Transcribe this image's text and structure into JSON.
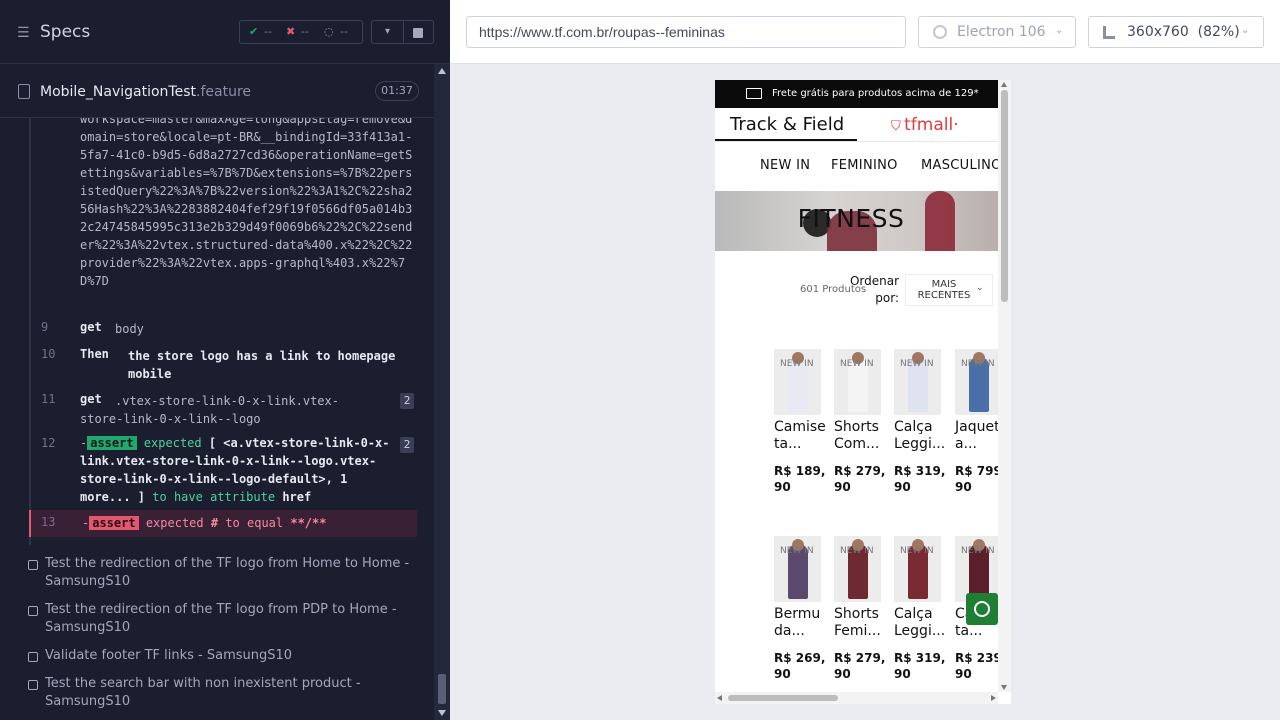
{
  "reporter": {
    "title": "Specs",
    "stats": {
      "passed": "--",
      "failed": "--",
      "pending": "--"
    },
    "file": {
      "name": "Mobile_NavigationTest",
      "ext": ".feature",
      "duration": "01:37"
    },
    "url_fragment": "workspace=master&maxAge=long&appsEtag=remove&domain=store&locale=pt-BR&__bindingId=33f413a1-5fa7-41c0-b9d5-6d8a2727cd36&operationName=getSettings&variables=%7B%7D&extensions=%7B%22persistedQuery%22%3A%7B%22version%22%3A1%2C%22sha256Hash%22%3A%2283882404fef29f19f0566df05a014b32c24745845995c313e2b329d49f0069b6%22%2C%22sender%22%3A%22vtex.structured-data%400.x%22%2C%22provider%22%3A%22vtex.apps-graphql%403.x%22%7D%7D",
    "commands": [
      {
        "line": "9",
        "name": "get",
        "message": "body"
      },
      {
        "line": "10",
        "name": "Then",
        "message": "the store logo has a link to homepage mobile"
      },
      {
        "line": "11",
        "name": "get",
        "message": ".vtex-store-link-0-x-link.vtex-store-link-0-x-link--logo",
        "count": "2"
      },
      {
        "line": "12",
        "prefix": "-",
        "name": "assert",
        "msg_a": "expected",
        "msg_b": "[ <a.vtex-store-link-0-x-link.vtex-store-link-0-x-link--logo.vtex-store-link-0-x-link--logo-default>, 1 more... ]",
        "msg_c": "to have attribute",
        "msg_d": "href",
        "count": "2"
      },
      {
        "line": "13",
        "prefix": "-",
        "name": "assert",
        "msg_a": "expected",
        "msg_b": "#",
        "msg_c": "to equal",
        "msg_d": "**/**"
      }
    ],
    "tests": [
      "Test the redirection of the TF logo from Home to Home - SamsungS10",
      "Test the redirection of the TF logo from PDP to Home - SamsungS10",
      "Validate footer TF links - SamsungS10",
      "Test the search bar with non inexistent product - SamsungS10"
    ]
  },
  "browser": {
    "url": "https://www.tf.com.br/roupas--femininas",
    "browser_name": "Electron 106",
    "viewport": "360x760  (82%)"
  },
  "site": {
    "promo": "Frete grátis para produtos acima de 129*",
    "brand_tf": "Track & Field",
    "brand_tfmall": " tfmall·",
    "nav": [
      "NEW IN",
      "FEMININO",
      "MASCULINO"
    ],
    "banner_title": "FITNESS",
    "product_count": "601 Produtos",
    "order_label": "Ordenar por:",
    "order_value": "MAIS RECENTES",
    "badge": "NEW IN",
    "products": [
      {
        "name": "Camise ta...",
        "price": "R$ 189, 90"
      },
      {
        "name": "Shorts Com...",
        "price": "R$ 279, 90"
      },
      {
        "name": "Calça Leggi...",
        "price": "R$ 319, 90"
      },
      {
        "name": "Jaquet a...",
        "price": "R$ 799, 90"
      },
      {
        "name": "Bermu da...",
        "price": "R$ 269, 90"
      },
      {
        "name": "Shorts Femi...",
        "price": "R$ 279, 90"
      },
      {
        "name": "Calça Leggi...",
        "price": "R$ 319, 90"
      },
      {
        "name": "Ca... ta...",
        "price": "R$ 239, 90"
      }
    ]
  }
}
